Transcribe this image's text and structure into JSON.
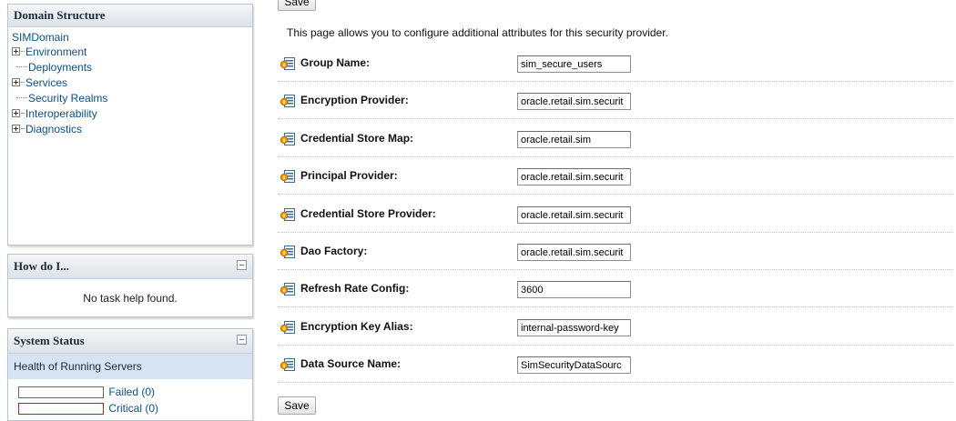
{
  "domain_panel": {
    "title": "Domain Structure",
    "root": "SIMDomain",
    "items": [
      {
        "label": "Environment",
        "expandable": true
      },
      {
        "label": "Deployments",
        "expandable": false
      },
      {
        "label": "Services",
        "expandable": true
      },
      {
        "label": "Security Realms",
        "expandable": false
      },
      {
        "label": "Interoperability",
        "expandable": true
      },
      {
        "label": "Diagnostics",
        "expandable": true
      }
    ]
  },
  "howdo_panel": {
    "title": "How do I...",
    "message": "No task help found."
  },
  "status_panel": {
    "title": "System Status",
    "subtitle": "Health of Running Servers",
    "rows": [
      {
        "label": "Failed (0)",
        "color": "#666666"
      },
      {
        "label": "Critical (0)",
        "color": "#b32222"
      }
    ]
  },
  "toolbar": {
    "save_label": "Save"
  },
  "intro_text": "This page allows you to configure additional attributes for this security provider.",
  "fields": [
    {
      "label": "Group Name:",
      "value": "sim_secure_users"
    },
    {
      "label": "Encryption Provider:",
      "value": "oracle.retail.sim.securit"
    },
    {
      "label": "Credential Store Map:",
      "value": "oracle.retail.sim"
    },
    {
      "label": "Principal Provider:",
      "value": "oracle.retail.sim.securit"
    },
    {
      "label": "Credential Store Provider:",
      "value": "oracle.retail.sim.securit"
    },
    {
      "label": "Dao Factory:",
      "value": "oracle.retail.sim.securit"
    },
    {
      "label": "Refresh Rate Config:",
      "value": "3600"
    },
    {
      "label": "Encryption Key Alias:",
      "value": "internal-password-key"
    },
    {
      "label": "Data Source Name:",
      "value": "SimSecurityDataSourc"
    }
  ],
  "icons": {
    "field_icon": "attribute-help-icon",
    "tree_expand_icon": "plus-box-icon",
    "collapse_icon": "minus-box-icon"
  },
  "colors": {
    "link": "#0b4f8a",
    "panel_border": "#b8c4d0",
    "status_highlight": "#d6e3f2"
  }
}
